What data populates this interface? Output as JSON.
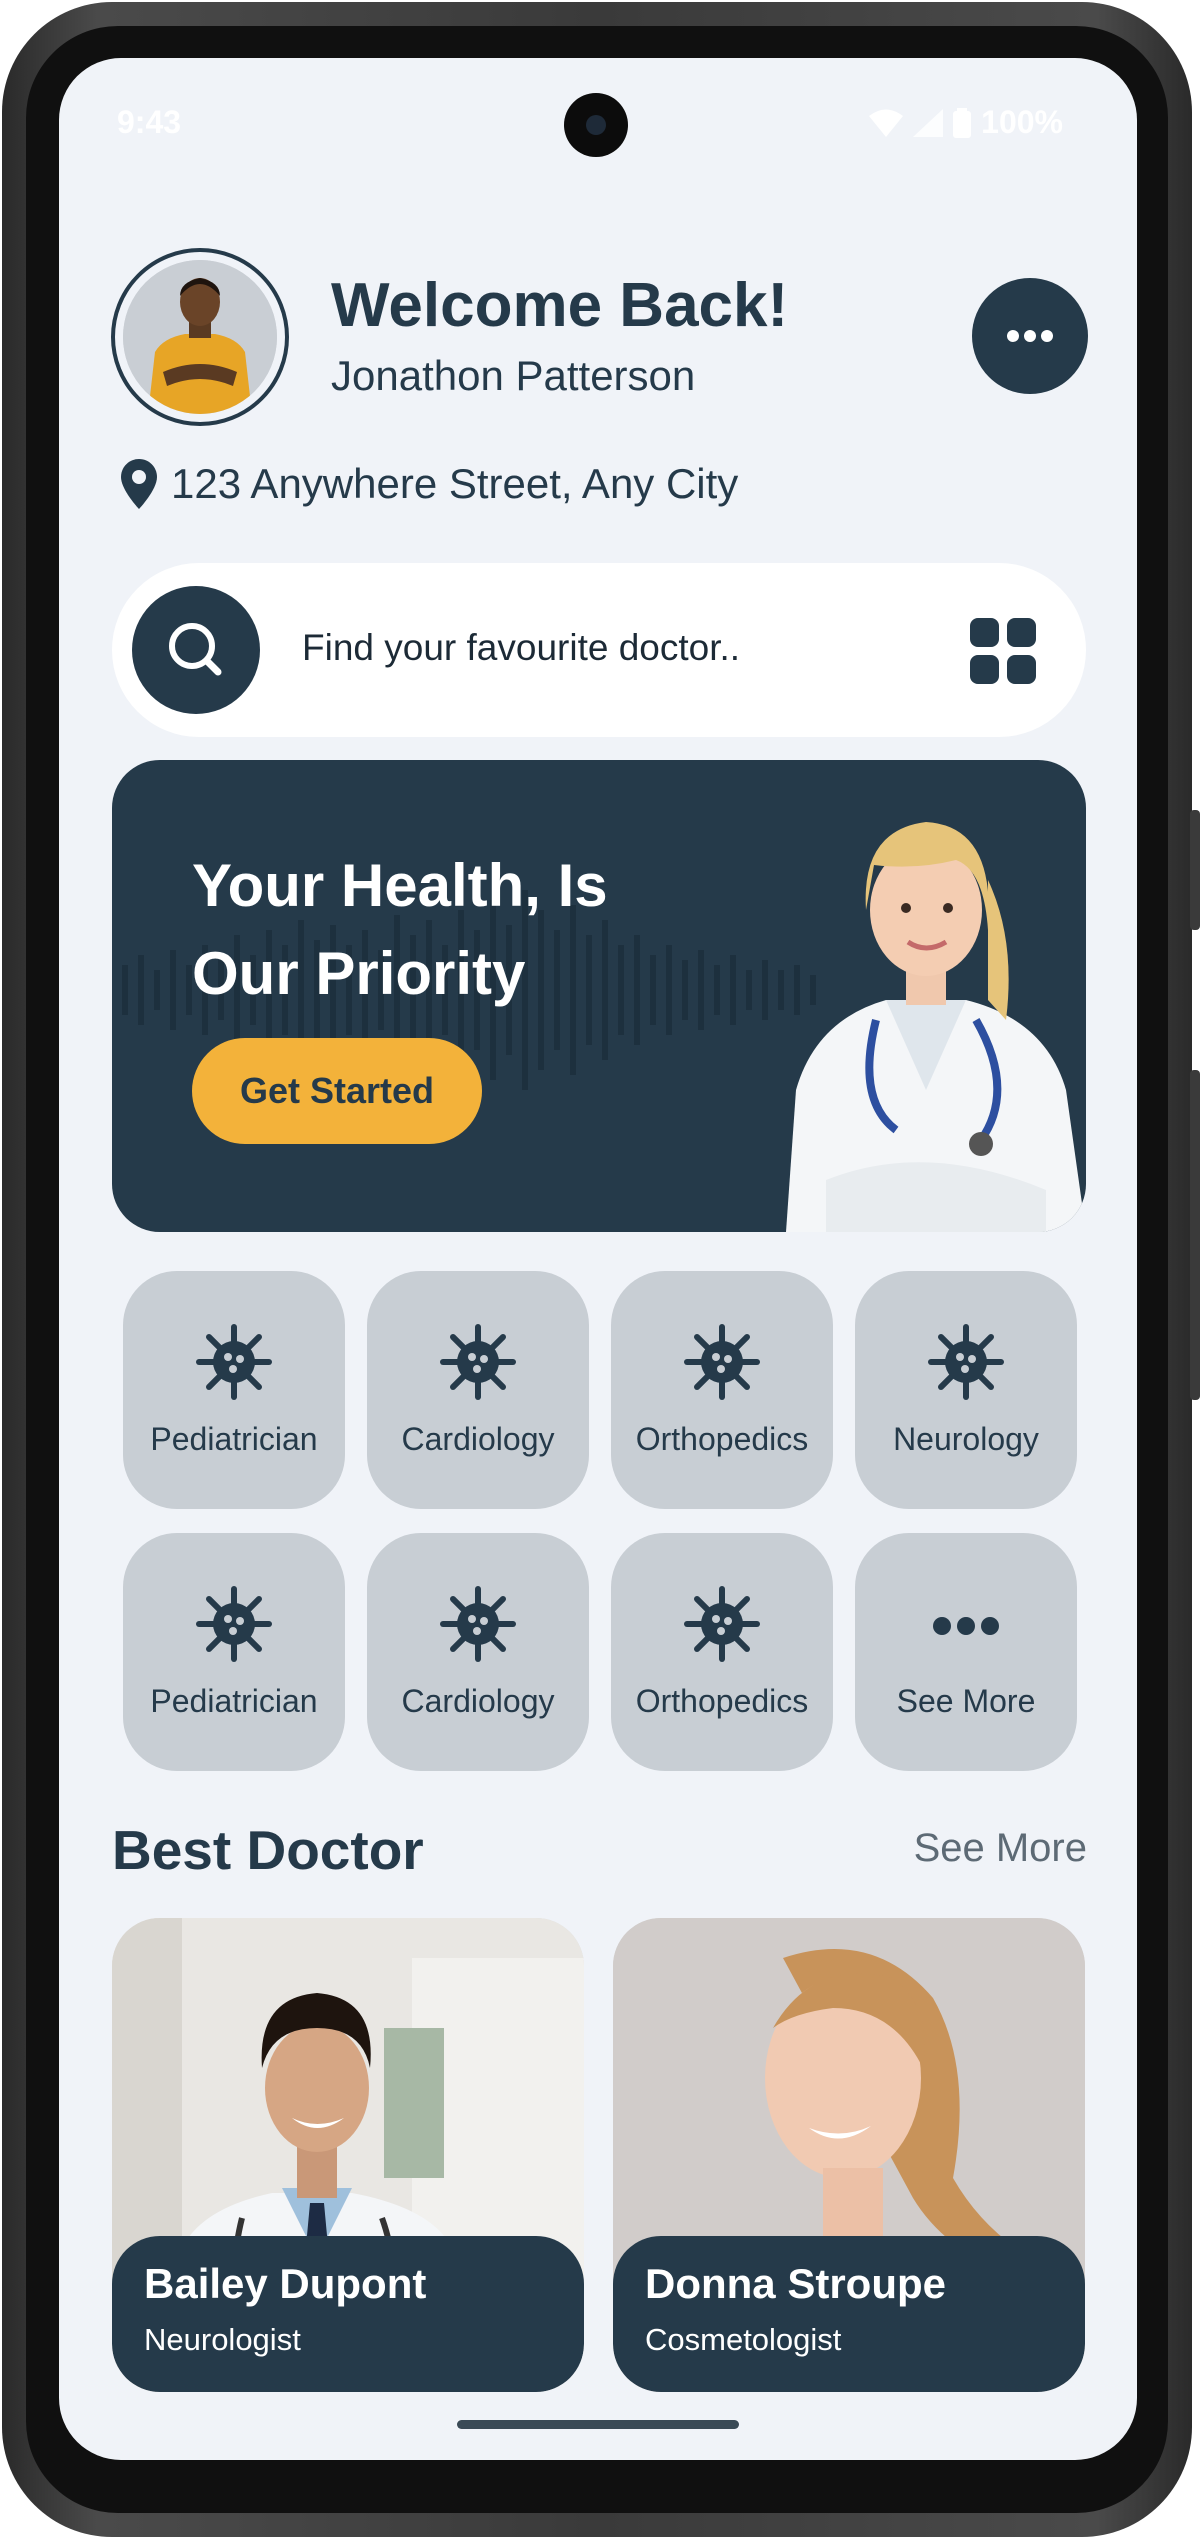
{
  "status_bar": {
    "time": "9:43",
    "battery": "100%"
  },
  "header": {
    "welcome": "Welcome Back!",
    "user_name": "Jonathon Patterson",
    "location": "123 Anywhere Street, Any City"
  },
  "search": {
    "placeholder": "Find your favourite doctor.."
  },
  "hero": {
    "title_line1": "Your Health, Is",
    "title_line2": "Our Priority",
    "button_label": "Get Started"
  },
  "categories": [
    {
      "label": "Pediatrician",
      "icon": "virus-icon"
    },
    {
      "label": "Cardiology",
      "icon": "virus-icon"
    },
    {
      "label": "Orthopedics",
      "icon": "virus-icon"
    },
    {
      "label": "Neurology",
      "icon": "virus-icon"
    },
    {
      "label": "Pediatrician",
      "icon": "virus-icon"
    },
    {
      "label": "Cardiology",
      "icon": "virus-icon"
    },
    {
      "label": "Orthopedics",
      "icon": "virus-icon"
    },
    {
      "label": "See More",
      "icon": "more-dots-icon"
    }
  ],
  "best_doctor": {
    "title": "Best Doctor",
    "see_more": "See More",
    "doctors": [
      {
        "name": "Bailey Dupont",
        "specialty": "Neurologist"
      },
      {
        "name": "Donna Stroupe",
        "specialty": "Cosmetologist"
      }
    ]
  },
  "colors": {
    "primary": "#253a4a",
    "accent": "#f3b23a",
    "background": "#f0f3f8",
    "category_bg": "#c8ced4"
  }
}
